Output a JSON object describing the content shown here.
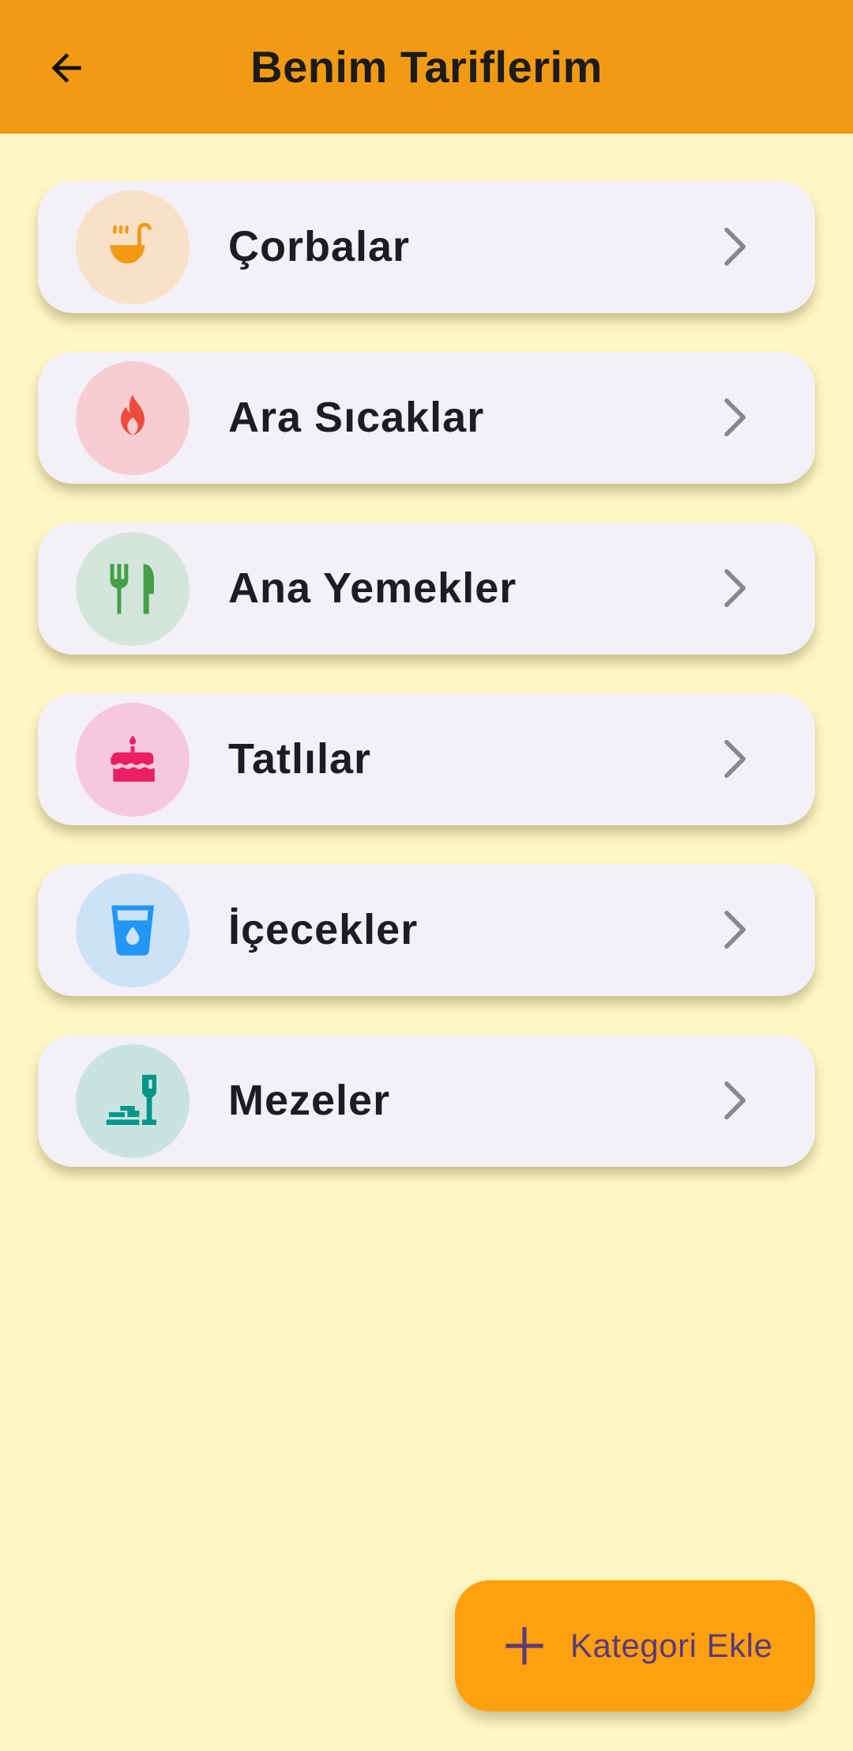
{
  "appbar": {
    "title": "Benim Tariflerim",
    "back_icon": "arrow-back-icon",
    "background": "#F29A14"
  },
  "categories": [
    {
      "label": "Çorbalar",
      "icon": "soup-ladle-icon",
      "icon_color": "#F29A14",
      "circle_color": "#F9E1C7"
    },
    {
      "label": "Ara Sıcaklar",
      "icon": "flame-icon",
      "icon_color": "#EF4B3C",
      "circle_color": "#F6CDD2"
    },
    {
      "label": "Ana Yemekler",
      "icon": "fork-knife-icon",
      "icon_color": "#43A047",
      "circle_color": "#D4E6DB"
    },
    {
      "label": "Tatlılar",
      "icon": "cake-icon",
      "icon_color": "#E91E63",
      "circle_color": "#F6C8DC"
    },
    {
      "label": "İçecekler",
      "icon": "water-glass-icon",
      "icon_color": "#2196F3",
      "circle_color": "#CDE1F7"
    },
    {
      "label": "Mezeler",
      "icon": "appetizer-wine-icon",
      "icon_color": "#009688",
      "circle_color": "#C9E3E1"
    }
  ],
  "fab": {
    "label": "Kategori Ekle",
    "icon": "plus-icon",
    "background": "#FFA00F"
  },
  "colors": {
    "page_background": "#FEF7C3",
    "card_background": "#F4F0F7"
  }
}
